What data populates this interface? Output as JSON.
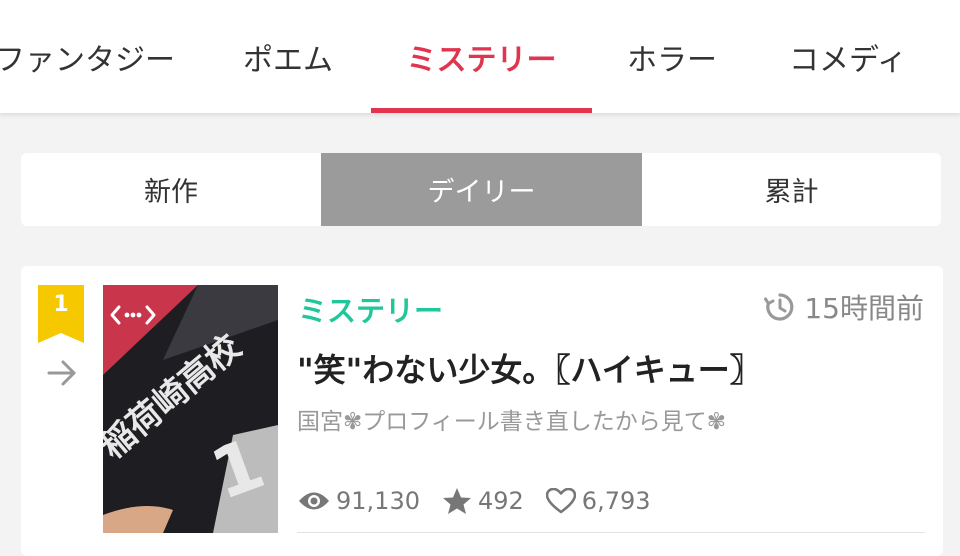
{
  "category_tabs": [
    {
      "label": "ファンタジー",
      "active": false
    },
    {
      "label": "ポエム",
      "active": false
    },
    {
      "label": "ミステリー",
      "active": true
    },
    {
      "label": "ホラー",
      "active": false
    },
    {
      "label": "コメディ",
      "active": false
    }
  ],
  "ranking_tabs": [
    {
      "label": "新作",
      "active": false
    },
    {
      "label": "デイリー",
      "active": true
    },
    {
      "label": "累計",
      "active": false
    }
  ],
  "story": {
    "rank": "1",
    "genre": "ミステリー",
    "time_ago": "15時間前",
    "title": "\"笑\"わない少女。〖ハイキュー〗",
    "author": "国宮✾プロフィール書き直したから見て✾",
    "views": "91,130",
    "stars": "492",
    "likes": "6,793",
    "thumbnail_text": "稲荷崎高校"
  },
  "colors": {
    "accent": "#e0344f",
    "genre": "#1fc79a",
    "rank_badge": "#f5c800",
    "segment_active": "#9b9b9b"
  },
  "icons": [
    "arrow-right-icon",
    "clock-icon",
    "eye-icon",
    "star-icon",
    "heart-icon",
    "expand-code-icon"
  ]
}
